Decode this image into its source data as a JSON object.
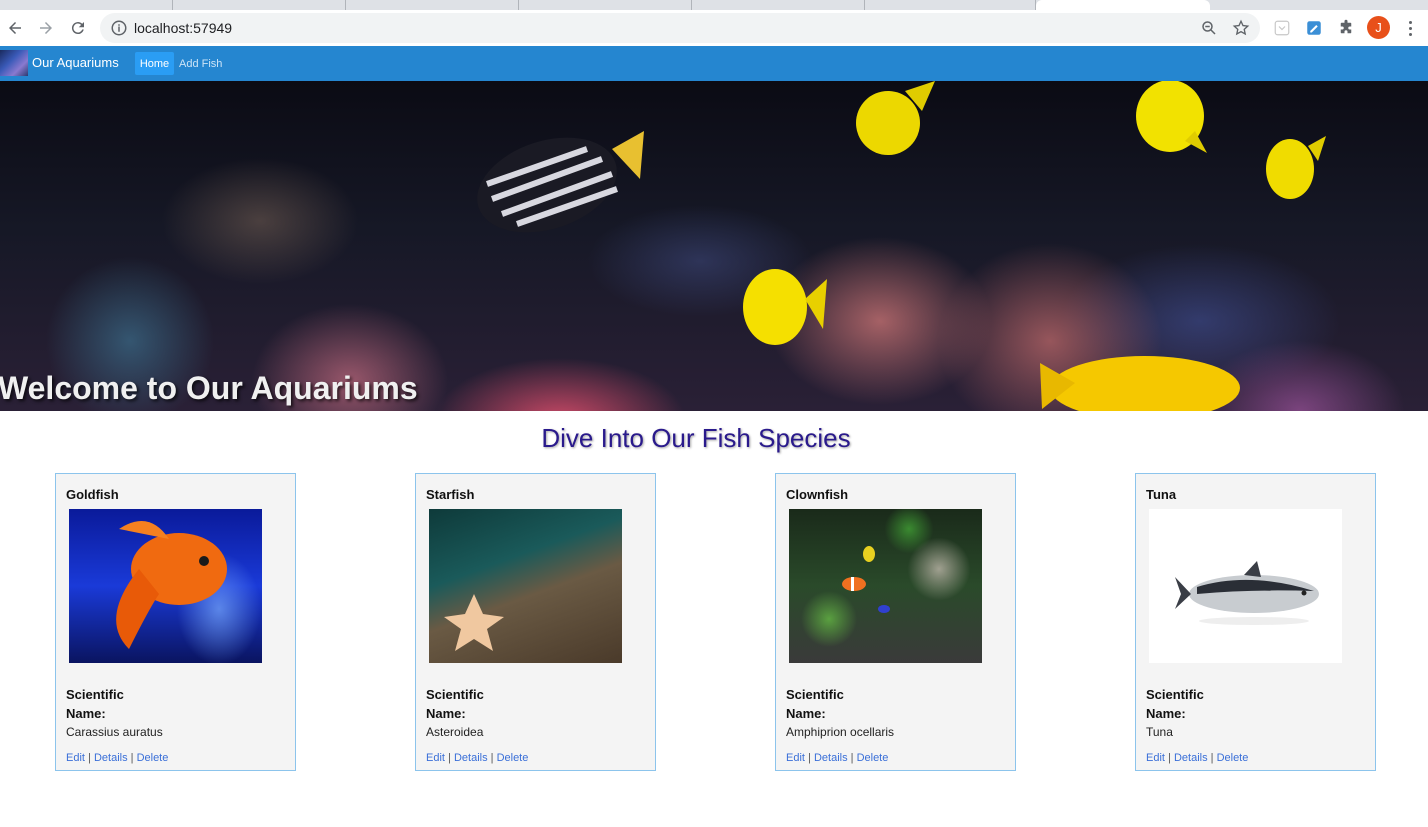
{
  "browser": {
    "url": "localhost:57949",
    "profile_initial": "J",
    "icons": [
      "back-icon",
      "forward-icon",
      "reload-icon",
      "info-icon",
      "zoom-icon",
      "star-icon",
      "extension-icon",
      "puzzle-icon",
      "menu-icon"
    ]
  },
  "site": {
    "brand": "Our Aquariums",
    "nav": {
      "home": "Home",
      "add_fish": "Add Fish"
    },
    "accent_color": "#2586d0"
  },
  "hero": {
    "title": "Welcome to Our Aquariums"
  },
  "section_title": "Dive Into Our Fish Species",
  "fish_cards": [
    {
      "name": "Goldfish",
      "label_line1": "Scientific",
      "label_line2": "Name:",
      "scientific_name": "Carassius auratus",
      "links": {
        "edit": "Edit",
        "details": "Details",
        "delete": "Delete"
      }
    },
    {
      "name": "Starfish",
      "label_line1": "Scientific",
      "label_line2": "Name:",
      "scientific_name": "Asteroidea",
      "links": {
        "edit": "Edit",
        "details": "Details",
        "delete": "Delete"
      }
    },
    {
      "name": "Clownfish",
      "label_line1": "Scientific",
      "label_line2": "Name:",
      "scientific_name": "Amphiprion ocellaris",
      "links": {
        "edit": "Edit",
        "details": "Details",
        "delete": "Delete"
      }
    },
    {
      "name": "Tuna",
      "label_line1": "Scientific",
      "label_line2": "Name:",
      "scientific_name": "Tuna",
      "links": {
        "edit": "Edit",
        "details": "Details",
        "delete": "Delete"
      }
    }
  ]
}
